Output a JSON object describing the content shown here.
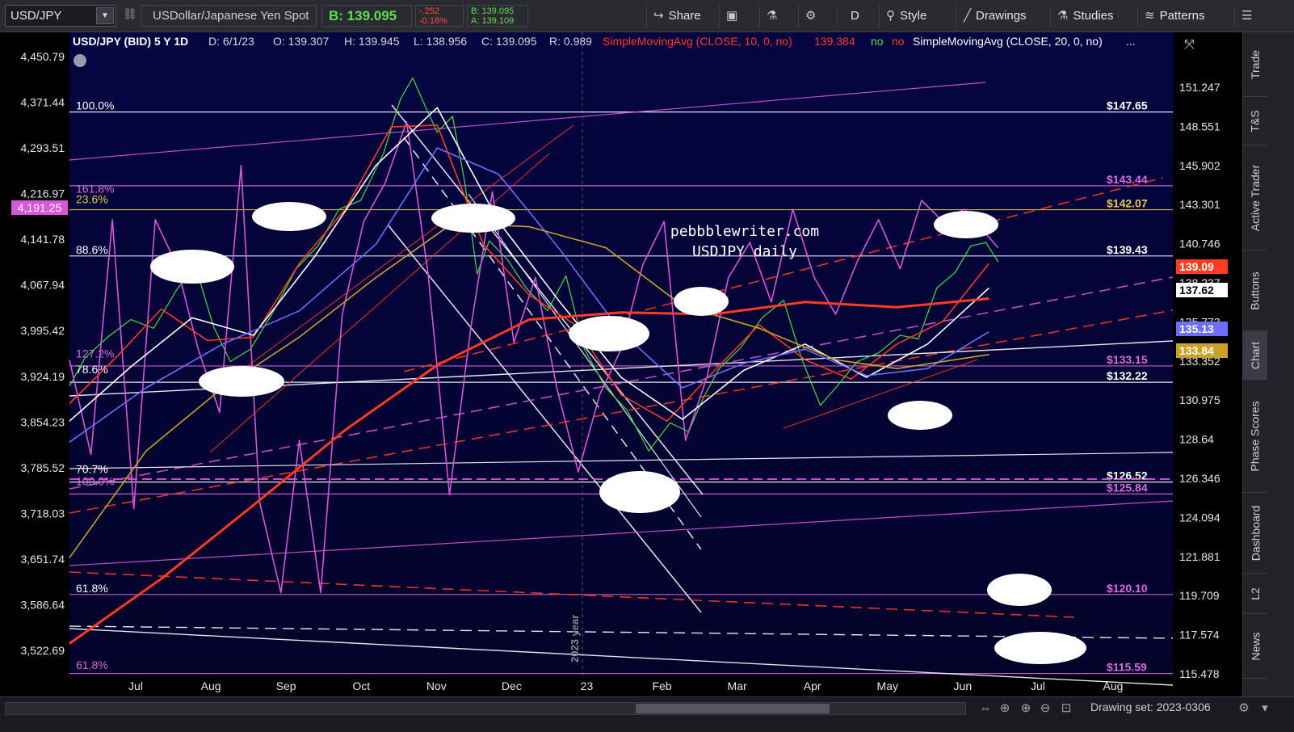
{
  "toolbar": {
    "symbol": "USD/JPY",
    "description": "USDollar/Japanese Yen Spot",
    "last": "B: 139.095",
    "change": "-.252",
    "change_pct": "-0.18%",
    "bid": "B: 139.095",
    "ask": "A: 139.109",
    "buttons": {
      "share": "Share",
      "period": "D",
      "style": "Style",
      "drawings": "Drawings",
      "studies": "Studies",
      "patterns": "Patterns"
    }
  },
  "chart_header": {
    "symbol": "USD/JPY (BID) 5 Y 1D",
    "date": "D: 6/1/23",
    "open": "O: 139.307",
    "high": "H: 139.945",
    "low": "L: 138.956",
    "close": "C: 139.095",
    "range": "R: 0.989",
    "sma10": "SimpleMovingAvg (CLOSE, 10, 0, no)",
    "sma10_val": "139.384",
    "no1": "no",
    "no2": "no",
    "sma20": "SimpleMovingAvg (CLOSE, 20, 0, no)",
    "ellipsis": "..."
  },
  "watermark": {
    "line1": "pebbblewriter.com",
    "line2": "USDJPY daily"
  },
  "divider_label": "2023 year",
  "chart_data": {
    "type": "line",
    "xlabel": "",
    "ylabel": "",
    "x_ticks": [
      "Jul",
      "Aug",
      "Sep",
      "Oct",
      "Nov",
      "Dec",
      "23",
      "Feb",
      "Mar",
      "Apr",
      "May",
      "Jun",
      "Jul",
      "Aug"
    ],
    "y_right_ticks": [
      "151.247",
      "148.551",
      "145.902",
      "143.301",
      "140.746",
      "138.237",
      "135.773",
      "133.352",
      "130.975",
      "128.64",
      "126.346",
      "124.094",
      "121.881",
      "119.709",
      "117.574",
      "115.478"
    ],
    "y_left_ticks": [
      "4,450.79",
      "4,371.44",
      "4,293.51",
      "4,216.97",
      "4,141.78",
      "4,067.94",
      "3,995.42",
      "3,924.19",
      "3,854.23",
      "3,785.52",
      "3,718.03",
      "3,651.74",
      "3,586.64",
      "3,522.69"
    ],
    "ylim": [
      115.478,
      152.2
    ],
    "left_badge": "4,191.25",
    "price_badges": [
      {
        "label": "139.09",
        "color": "#ff3b20"
      },
      {
        "label": "137.62",
        "color": "#ffffff"
      },
      {
        "label": "135.13",
        "color": "#6d6dff"
      },
      {
        "label": "133.84",
        "color": "#c9a227"
      }
    ],
    "level_labels": [
      {
        "text": "$147.65",
        "value": 147.65,
        "color": "#ffffff"
      },
      {
        "text": "$143.44",
        "value": 143.44,
        "color": "#d86bd8"
      },
      {
        "text": "$142.07",
        "value": 142.07,
        "color": "#e6c94a"
      },
      {
        "text": "$139.43",
        "value": 139.43,
        "color": "#ffffff"
      },
      {
        "text": "$133.15",
        "value": 133.15,
        "color": "#d86bd8"
      },
      {
        "text": "$132.22",
        "value": 132.22,
        "color": "#ffffff"
      },
      {
        "text": "$126.52",
        "value": 126.52,
        "color": "#ffffff"
      },
      {
        "text": "$125.84",
        "value": 125.84,
        "color": "#d86bd8"
      },
      {
        "text": "$120.10",
        "value": 120.1,
        "color": "#d86bd8"
      },
      {
        "text": "$115.59",
        "value": 115.59,
        "color": "#d86bd8"
      }
    ],
    "fib_labels": [
      {
        "text": "100.0%",
        "value": 147.65,
        "color": "#ffffff"
      },
      {
        "text": "161.8%",
        "value": 142.9,
        "color": "#d86bd8"
      },
      {
        "text": "23.6%",
        "value": 142.3,
        "color": "#e6c94a"
      },
      {
        "text": "88.6%",
        "value": 139.43,
        "color": "#ffffff"
      },
      {
        "text": "127.2%",
        "value": 133.5,
        "color": "#d86bd8"
      },
      {
        "text": "78.6%",
        "value": 132.6,
        "color": "#ffffff"
      },
      {
        "text": "70.7%",
        "value": 126.9,
        "color": "#ffffff"
      },
      {
        "text": "100.0%",
        "value": 126.2,
        "color": "#d86bd8"
      },
      {
        "text": "61.8%",
        "value": 120.1,
        "color": "#ffffff"
      },
      {
        "text": "61.8%",
        "value": 115.7,
        "color": "#d86bd8"
      }
    ],
    "series": [
      {
        "name": "price",
        "color": "#3fd13f",
        "points": [
          [
            0,
            132.0
          ],
          [
            10,
            133.6
          ],
          [
            25,
            134.8
          ],
          [
            40,
            135.8
          ],
          [
            55,
            135.3
          ],
          [
            70,
            137.5
          ],
          [
            82,
            138.9
          ],
          [
            94,
            135.4
          ],
          [
            105,
            133.4
          ],
          [
            118,
            134.1
          ],
          [
            132,
            136.1
          ],
          [
            148,
            138.7
          ],
          [
            162,
            140.0
          ],
          [
            176,
            142.1
          ],
          [
            190,
            142.6
          ],
          [
            205,
            145.3
          ],
          [
            216,
            148.4
          ],
          [
            224,
            149.6
          ],
          [
            232,
            148.0
          ],
          [
            240,
            146.5
          ],
          [
            250,
            147.4
          ],
          [
            258,
            143.6
          ],
          [
            266,
            138.4
          ],
          [
            274,
            140.3
          ],
          [
            286,
            139.2
          ],
          [
            298,
            137.6
          ],
          [
            312,
            136.3
          ],
          [
            324,
            138.3
          ],
          [
            336,
            134.1
          ],
          [
            350,
            131.9
          ],
          [
            364,
            130.6
          ],
          [
            378,
            128.3
          ],
          [
            392,
            129.9
          ],
          [
            404,
            129.4
          ],
          [
            414,
            131.4
          ],
          [
            424,
            133.0
          ],
          [
            438,
            134.2
          ],
          [
            452,
            135.9
          ],
          [
            466,
            136.9
          ],
          [
            478,
            133.5
          ],
          [
            490,
            130.9
          ],
          [
            500,
            131.9
          ],
          [
            514,
            133.4
          ],
          [
            528,
            133.9
          ],
          [
            542,
            134.9
          ],
          [
            554,
            134.7
          ],
          [
            566,
            137.6
          ],
          [
            578,
            138.5
          ],
          [
            588,
            140.0
          ],
          [
            598,
            140.2
          ],
          [
            606,
            139.1
          ]
        ]
      },
      {
        "name": "",
        "color": "#d856d8",
        "points": [
          [
            0,
            133.5
          ],
          [
            14,
            128.1
          ],
          [
            28,
            141.5
          ],
          [
            42,
            125.0
          ],
          [
            56,
            141.5
          ],
          [
            70,
            138.9
          ],
          [
            84,
            134.1
          ],
          [
            98,
            130.5
          ],
          [
            112,
            144.6
          ],
          [
            124,
            125.4
          ],
          [
            138,
            120.2
          ],
          [
            150,
            128.9
          ],
          [
            164,
            120.2
          ],
          [
            178,
            136.1
          ],
          [
            192,
            141.4
          ],
          [
            206,
            143.6
          ],
          [
            220,
            147.1
          ],
          [
            234,
            138.4
          ],
          [
            248,
            125.8
          ],
          [
            262,
            135.4
          ],
          [
            276,
            143.1
          ],
          [
            290,
            134.5
          ],
          [
            304,
            138.2
          ],
          [
            318,
            131.9
          ],
          [
            332,
            127.1
          ],
          [
            346,
            131.5
          ],
          [
            360,
            134.1
          ],
          [
            374,
            138.9
          ],
          [
            388,
            141.4
          ],
          [
            402,
            128.9
          ],
          [
            416,
            132.5
          ],
          [
            430,
            138.2
          ],
          [
            444,
            140.2
          ],
          [
            458,
            136.8
          ],
          [
            472,
            142.1
          ],
          [
            486,
            138.2
          ],
          [
            500,
            136.1
          ],
          [
            514,
            139.1
          ],
          [
            528,
            141.5
          ],
          [
            542,
            138.7
          ],
          [
            556,
            142.6
          ],
          [
            570,
            141.4
          ],
          [
            584,
            142.1
          ],
          [
            598,
            140.7
          ],
          [
            606,
            139.9
          ]
        ]
      },
      {
        "name": "",
        "color": "#ff3b20",
        "points": [
          [
            0,
            131.0
          ],
          [
            30,
            133.6
          ],
          [
            60,
            136.4
          ],
          [
            90,
            134.6
          ],
          [
            120,
            134.8
          ],
          [
            150,
            139.0
          ],
          [
            180,
            142.1
          ],
          [
            210,
            146.8
          ],
          [
            240,
            146.9
          ],
          [
            270,
            140.1
          ],
          [
            300,
            137.2
          ],
          [
            330,
            135.5
          ],
          [
            360,
            131.5
          ],
          [
            390,
            130.0
          ],
          [
            420,
            132.8
          ],
          [
            450,
            135.5
          ],
          [
            480,
            133.5
          ],
          [
            510,
            132.4
          ],
          [
            540,
            134.4
          ],
          [
            570,
            135.7
          ],
          [
            600,
            139.0
          ]
        ]
      },
      {
        "name": "",
        "color": "#ffffff",
        "points": [
          [
            0,
            130.0
          ],
          [
            40,
            133.1
          ],
          [
            80,
            135.9
          ],
          [
            120,
            134.9
          ],
          [
            160,
            139.4
          ],
          [
            200,
            144.6
          ],
          [
            240,
            147.9
          ],
          [
            280,
            141.4
          ],
          [
            320,
            136.8
          ],
          [
            360,
            132.5
          ],
          [
            400,
            130.1
          ],
          [
            440,
            132.9
          ],
          [
            480,
            134.4
          ],
          [
            520,
            132.5
          ],
          [
            560,
            134.4
          ],
          [
            600,
            137.6
          ]
        ]
      },
      {
        "name": "",
        "color": "#6d6dff",
        "points": [
          [
            0,
            128.8
          ],
          [
            50,
            131.9
          ],
          [
            100,
            134.4
          ],
          [
            150,
            136.3
          ],
          [
            200,
            140.1
          ],
          [
            240,
            145.6
          ],
          [
            280,
            144.1
          ],
          [
            320,
            139.8
          ],
          [
            360,
            135.1
          ],
          [
            400,
            131.9
          ],
          [
            440,
            133.3
          ],
          [
            480,
            134.1
          ],
          [
            520,
            132.6
          ],
          [
            560,
            133.0
          ],
          [
            600,
            135.1
          ]
        ]
      },
      {
        "name": "",
        "color": "#c9a227",
        "points": [
          [
            0,
            122.2
          ],
          [
            50,
            128.3
          ],
          [
            100,
            131.9
          ],
          [
            150,
            134.8
          ],
          [
            200,
            138.2
          ],
          [
            250,
            141.3
          ],
          [
            300,
            141.1
          ],
          [
            350,
            139.9
          ],
          [
            400,
            136.6
          ],
          [
            450,
            135.3
          ],
          [
            500,
            133.5
          ],
          [
            540,
            133.0
          ],
          [
            600,
            133.8
          ]
        ]
      },
      {
        "name": "",
        "color": "#ff3b20",
        "points": [
          [
            0,
            117.3
          ],
          [
            60,
            121.0
          ],
          [
            120,
            125.2
          ],
          [
            180,
            129.5
          ],
          [
            240,
            133.2
          ],
          [
            300,
            135.8
          ],
          [
            360,
            136.2
          ],
          [
            420,
            136.1
          ],
          [
            480,
            136.8
          ],
          [
            540,
            136.5
          ],
          [
            600,
            137.0
          ]
        ]
      }
    ],
    "x_domain": [
      0,
      720
    ]
  },
  "side_tabs": [
    "Trade",
    "T&S",
    "Active Trader",
    "Buttons",
    "Chart",
    "Phase Scores",
    "Dashboard",
    "L2",
    "News"
  ],
  "bottom": {
    "drawing_set": "Drawing set: 2023-0306"
  }
}
